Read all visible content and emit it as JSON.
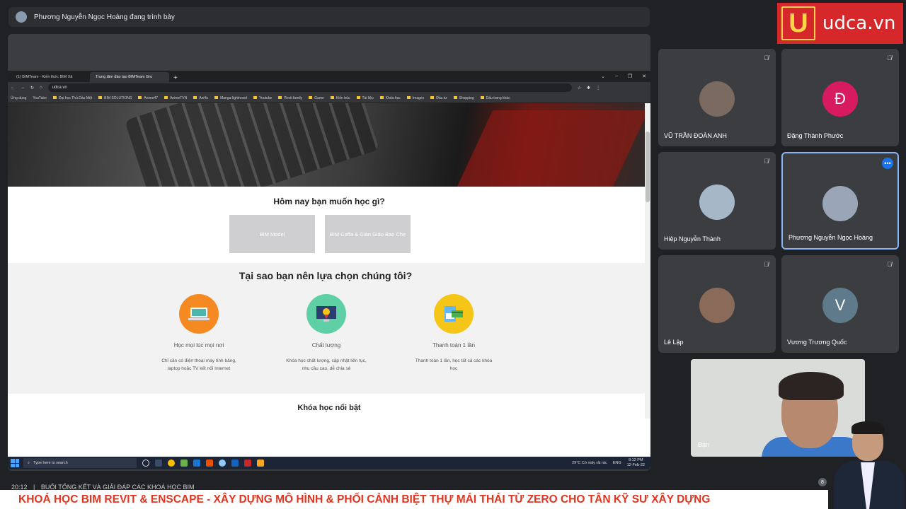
{
  "presenter": {
    "label": "Phương Nguyễn Ngọc Hoàng đang trình bày"
  },
  "logo": {
    "mark": "U",
    "text": "udca.vn",
    "bg_color": "#d6272a",
    "mark_color": "#ffd34a"
  },
  "browser": {
    "tabs": [
      {
        "label": "(1) BIMTeam - Kiến thức BIM Xâ"
      },
      {
        "label": "Trung tâm đào tạo BIMTeam Gro"
      }
    ],
    "new_tab": "+",
    "window_controls": [
      "⌄",
      "–",
      "❐",
      "✕"
    ],
    "url": "udca.vn",
    "bookmarks": [
      "Ứng dụng",
      "YouTube",
      "Đại học Thủ Dầu Một",
      "BIM SOLUTIONS",
      "Anime47",
      "AnimeTVN",
      "Ani4u",
      "Manga-lightnovel",
      "Youtube",
      "Revit family",
      "Game",
      "Kiến trúc",
      "Tài liệu",
      "Khóa học",
      "Images",
      "Đầu tư",
      "Shopping"
    ],
    "other_bookmarks": "Dấu trang khác"
  },
  "site": {
    "learn_title": "Hôm nay bạn muốn học gì?",
    "learn_buttons": [
      "BIM Model",
      "BIM Coffa & Giàn Giáo Bao Che"
    ],
    "why_title": "Tại sao bạn nên lựa chọn chúng tôi?",
    "features": [
      {
        "title": "Học mọi lúc mọi nơi",
        "desc": "Chỉ cần có điện thoại máy tính bảng, laptop hoặc TV kết nối Internet",
        "icon": "laptop-icon",
        "color": "#f58a23"
      },
      {
        "title": "Chất lượng",
        "desc": "Khóa học chất lượng, cập nhật liên tục, nhu cầu cao, dễ chia sẻ",
        "icon": "award-monitor-icon",
        "color": "#5fd0a6"
      },
      {
        "title": "Thanh toán 1 lần",
        "desc": "Thanh toán 1 lần, học tất cả các khóa học",
        "icon": "payment-card-icon",
        "color": "#f5c518"
      }
    ],
    "featured_title": "Khóa học nổi bật"
  },
  "taskbar": {
    "search_placeholder": "Type here to search",
    "weather": "29°C  Có mây rải rác",
    "lang": "ENG",
    "time": "8:12 PM",
    "date": "12-Feb-22"
  },
  "participants": [
    {
      "name": "VŨ TRẦN ĐOÀN ANH",
      "initial": "",
      "avatar_color": "#7a6a60",
      "muted": true,
      "active": false
    },
    {
      "name": "Đặng Thành Phước",
      "initial": "Đ",
      "avatar_color": "#d81b60",
      "muted": true,
      "active": false
    },
    {
      "name": "Hiệp Nguyễn Thành",
      "initial": "",
      "avatar_color": "#a6b8c8",
      "muted": true,
      "active": false
    },
    {
      "name": "Phương Nguyễn Ngọc Hoàng",
      "initial": "",
      "avatar_color": "#9aa6b8",
      "muted": false,
      "active": true
    },
    {
      "name": "Lê Lập",
      "initial": "",
      "avatar_color": "#8a6a58",
      "muted": true,
      "active": false
    },
    {
      "name": "Vương Trương Quốc",
      "initial": "V",
      "avatar_color": "#5f7a8a",
      "muted": true,
      "active": false
    }
  ],
  "self_view": {
    "label": "Bạn"
  },
  "meeting": {
    "time": "20:12",
    "title": "BUỔI TỔNG KẾT VÀ GIẢI ĐÁP CÁC KHOÁ HỌC BIM",
    "people_count": "8"
  },
  "banner": {
    "text": "KHOÁ HỌC BIM REVIT & ENSCAPE - XÂY DỰNG MÔ HÌNH & PHỐI CẢNH BIỆT THỰ MÁI THÁI TỪ ZERO CHO TÂN KỸ SƯ XÂY DỰNG"
  }
}
